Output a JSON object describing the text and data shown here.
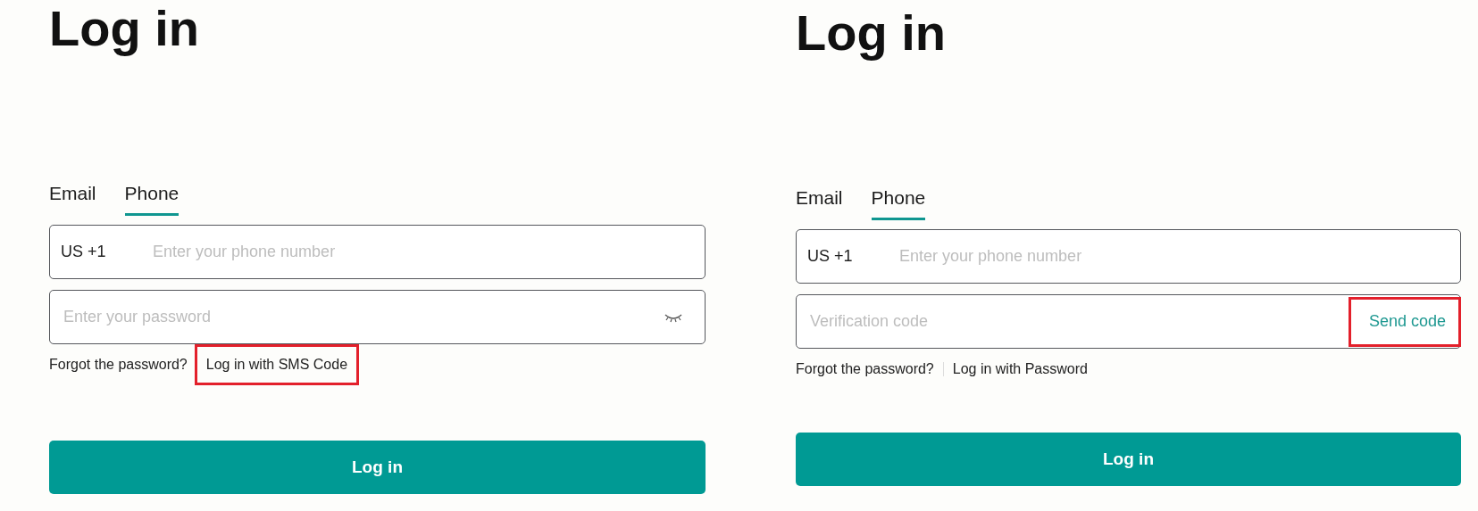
{
  "panels": [
    {
      "title": "Log in",
      "tabs": [
        {
          "label": "Email",
          "selected": false
        },
        {
          "label": "Phone",
          "selected": true
        }
      ],
      "phone": {
        "prefix": "US +1",
        "placeholder": "Enter your phone number"
      },
      "secret": {
        "kind": "password",
        "placeholder": "Enter your password"
      },
      "separator": false,
      "links": [
        {
          "label": "Forgot the password?",
          "highlighted": false
        },
        {
          "label": "Log in with SMS Code",
          "highlighted": true
        }
      ],
      "submit": "Log in"
    },
    {
      "title": "Log in",
      "tabs": [
        {
          "label": "Email",
          "selected": false
        },
        {
          "label": "Phone",
          "selected": true
        }
      ],
      "phone": {
        "prefix": "US +1",
        "placeholder": "Enter your phone number"
      },
      "secret": {
        "kind": "code",
        "placeholder": "Verification code",
        "action": {
          "label": "Send code",
          "highlighted": true
        }
      },
      "separator": true,
      "links": [
        {
          "label": "Forgot the password?",
          "highlighted": false
        },
        {
          "label": "Log in with Password",
          "highlighted": false
        }
      ],
      "submit": "Log in"
    }
  ]
}
